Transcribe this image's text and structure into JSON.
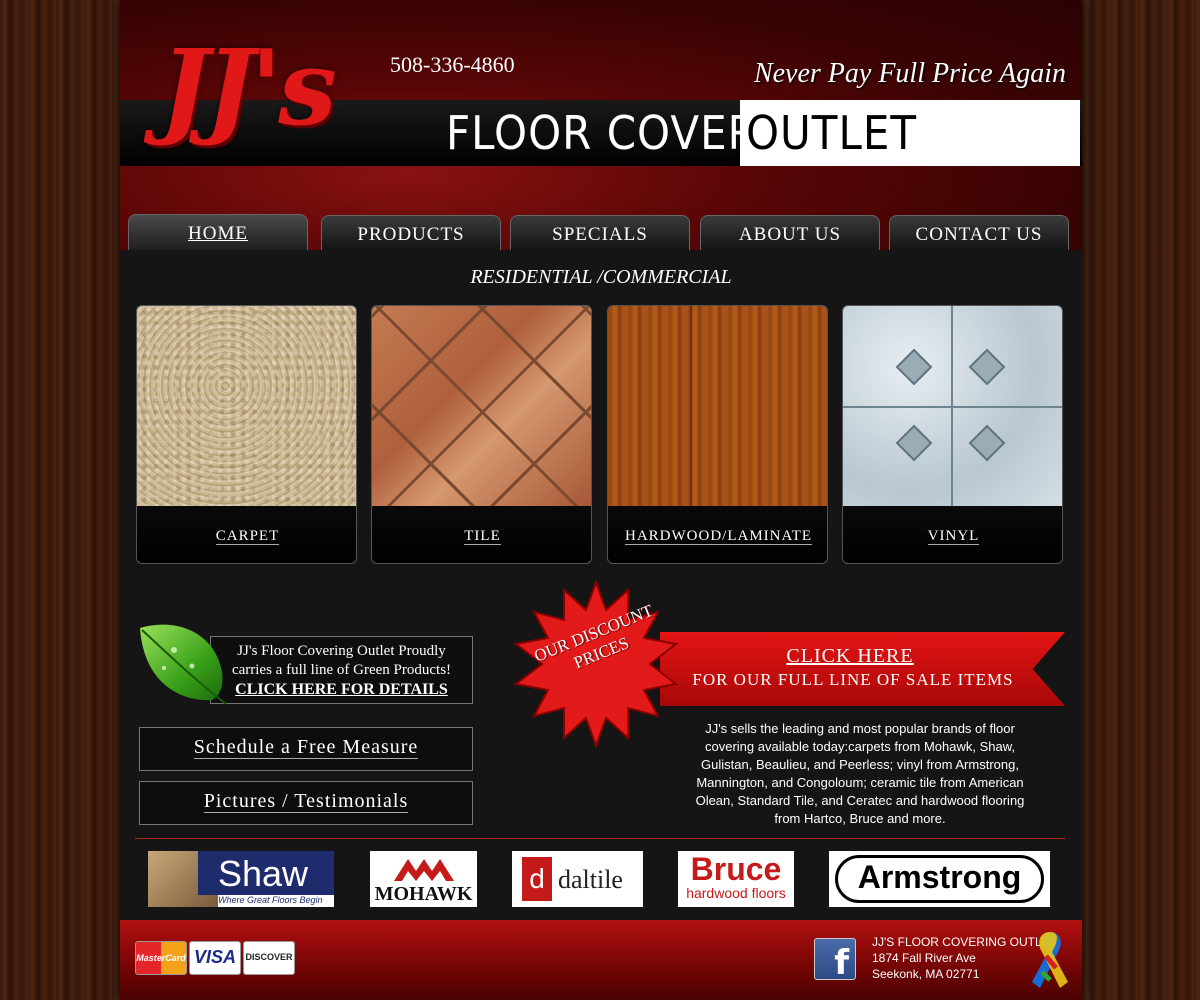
{
  "header": {
    "logo_text": "JJ's",
    "phone": "508-336-4860",
    "tagline": "Never Pay Full Price Again",
    "brand_part1": "FLOOR COVERING",
    "brand_part2": "OUTLET"
  },
  "nav": {
    "tabs": [
      {
        "label": "HOME"
      },
      {
        "label": "PRODUCTS"
      },
      {
        "label": "SPECIALS"
      },
      {
        "label": "ABOUT US"
      },
      {
        "label": "CONTACT US"
      }
    ]
  },
  "main": {
    "section_title": "RESIDENTIAL /COMMERCIAL",
    "categories": [
      {
        "label": "CARPET"
      },
      {
        "label": "TILE"
      },
      {
        "label": "HARDWOOD/LAMINATE"
      },
      {
        "label": "VINYL"
      }
    ],
    "green": {
      "line1": "JJ's Floor Covering Outlet Proudly",
      "line2": "carries a full line of Green Products!",
      "link": "CLICK HERE FOR DETAILS"
    },
    "schedule_label": "Schedule a Free Measure",
    "pictures_label": "Pictures / Testimonials",
    "discount_badge": "OUR DISCOUNT PRICES",
    "sale_click": "CLICK HERE",
    "sale_line": "FOR OUR FULL LINE OF SALE ITEMS",
    "brands_text": "JJ's sells the leading and most popular brands of floor covering available today:carpets from Mohawk, Shaw, Gulistan, Beaulieu, and Peerless; vinyl from Armstrong, Mannington, and Congoloum; ceramic tile from American Olean, Standard Tile, and Ceratec and hardwood flooring from Hartco, Bruce and more."
  },
  "brand_logos": [
    {
      "name": "Shaw",
      "sub": "Where Great Floors Begin"
    },
    {
      "name": "MOHAWK"
    },
    {
      "name": "daltile"
    },
    {
      "name": "Bruce",
      "sub": "hardwood floors"
    },
    {
      "name": "Armstrong"
    }
  ],
  "footer": {
    "payments": [
      "MasterCard",
      "VISA",
      "DISCOVER"
    ],
    "business_name": "JJ'S FLOOR COVERING OUTLET",
    "street": "1874 Fall River Ave",
    "city": "Seekonk, MA 02771"
  },
  "colors": {
    "accent_red": "#e01818",
    "header_dark_red": "#5a0606",
    "content_bg": "#151515"
  },
  "icons": [
    "facebook-icon",
    "awareness-ribbon-icon",
    "leaf-icon"
  ]
}
